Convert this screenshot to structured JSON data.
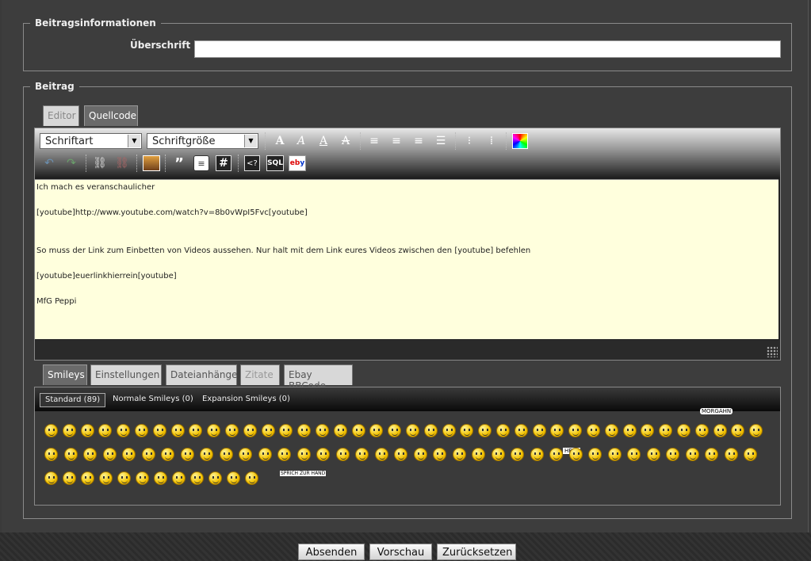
{
  "post_info": {
    "legend": "Beitragsinformationen",
    "title_label": "Überschrift",
    "title_value": ""
  },
  "post": {
    "legend": "Beitrag",
    "editor_tabs": [
      "Editor",
      "Quellcode"
    ],
    "active_editor_tab": "Quellcode",
    "font_select": "Schriftart",
    "size_select": "Schriftgröße",
    "toolbar_icons": [
      "bold-icon",
      "italic-icon",
      "underline-icon",
      "strikethrough-icon",
      "align-left-icon",
      "align-center-icon",
      "align-right-icon",
      "justify-icon",
      "bullet-list-icon",
      "numbered-list-icon",
      "color-picker-icon",
      "undo-icon",
      "redo-icon",
      "link-icon",
      "unlink-icon",
      "image-icon",
      "quote-icon",
      "speech-bubble-icon",
      "hash-icon",
      "code-icon",
      "sql-icon",
      "ebay-icon"
    ],
    "sql_label": "SQL",
    "hash_label": "#",
    "content": "Ich mach es veranschaulicher\n\n[youtube]http://www.youtube.com/watch?v=8b0vWpI5Fvc[youtube]\n\n\nSo muss der Link zum Einbetten von Videos aussehen. Nur halt mit dem Link eures Videos zwischen den [youtube] befehlen\n\n[youtube]euerlinkhierrein[youtube]\n\nMfG Peppi"
  },
  "bottom_tabs": [
    "Smileys",
    "Einstellungen",
    "Dateianhänge",
    "Zitate",
    "Ebay BBCode"
  ],
  "active_bottom_tab": "Smileys",
  "smiley_tabs": [
    "Standard (89)",
    "Normale Smileys (0)",
    "Expansion Smileys (0)"
  ],
  "smiley_count": 89,
  "smiley_captions": {
    "morgahn": "MORGÄHN",
    "help": "HELP",
    "sprich": "SPRICH ZUR HAND"
  },
  "buttons": {
    "submit": "Absenden",
    "preview": "Vorschau",
    "reset": "Zurücksetzen"
  },
  "colors": {
    "background": "#3d3d3d",
    "textarea_bg": "#ffffdd",
    "smiley_yellow": "#f2c200"
  }
}
